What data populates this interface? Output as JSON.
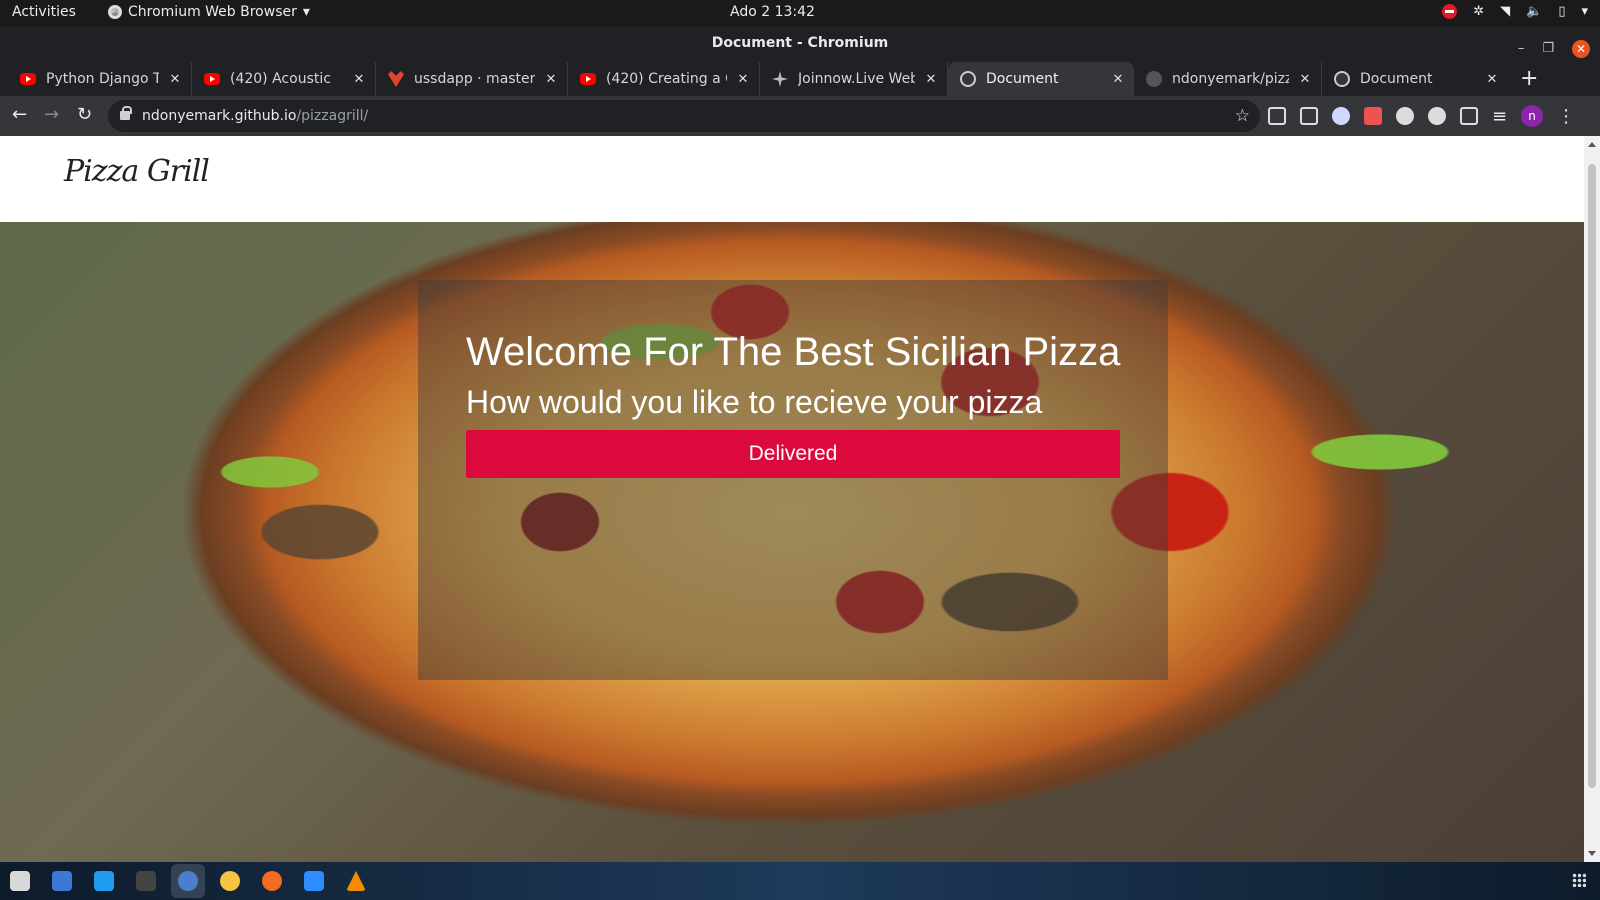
{
  "system": {
    "activities": "Activities",
    "app_menu": "Chromium Web Browser",
    "clock": "Ado 2  13:42"
  },
  "window": {
    "title": "Document - Chromium"
  },
  "tabs": [
    {
      "label": "Python Django Tu",
      "icon": "youtube-icon"
    },
    {
      "label": "(420) Acoustic",
      "icon": "youtube-icon"
    },
    {
      "label": "ussdapp · master",
      "icon": "gitlab-icon"
    },
    {
      "label": "(420) Creating a C",
      "icon": "youtube-icon"
    },
    {
      "label": "Joinnow.Live Web",
      "icon": "joinnow-icon"
    },
    {
      "label": "Document",
      "icon": "globe-icon",
      "active": true
    },
    {
      "label": "ndonyemark/pizza",
      "icon": "github-icon"
    },
    {
      "label": "Document",
      "icon": "globe-icon"
    }
  ],
  "address_bar": {
    "host": "ndonyemark.github.io",
    "path": "/pizzagrill/"
  },
  "profile_initial": "n",
  "site": {
    "logo": "Pizza Grill",
    "hero_title": "Welcome For The Best Sicilian Pizza",
    "hero_subtitle": "How would you like to recieve your pizza",
    "cta_label": "Delivered"
  },
  "colors": {
    "cta": "#dc0a3c",
    "browser_chrome": "#35363a"
  }
}
